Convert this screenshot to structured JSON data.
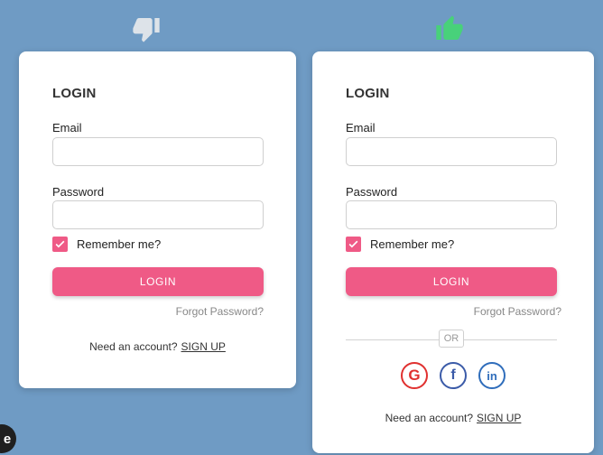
{
  "top_icons": {
    "left": {
      "icon": "thumbs-down-icon",
      "color": "#dde3e9"
    },
    "right": {
      "icon": "thumbs-up-icon",
      "color": "#48d17a"
    }
  },
  "left_card": {
    "title": "LOGIN",
    "email_label": "Email",
    "email_value": "",
    "password_label": "Password",
    "password_value": "",
    "remember_label": "Remember me?",
    "remember_checked": true,
    "login_button": "LOGIN",
    "forgot_password": "Forgot Password?",
    "signup_text": "Need an account?",
    "signup_link": "SIGN UP"
  },
  "right_card": {
    "title": "LOGIN",
    "email_label": "Email",
    "email_value": "",
    "password_label": "Password",
    "password_value": "",
    "remember_label": "Remember me?",
    "remember_checked": true,
    "login_button": "LOGIN",
    "forgot_password": "Forgot Password?",
    "divider_text": "OR",
    "social": [
      {
        "name": "Google",
        "glyph": "G",
        "icon": "google-icon",
        "color": "#e0302f"
      },
      {
        "name": "Facebook",
        "glyph": "f",
        "icon": "facebook-icon",
        "color": "#3b5ba8"
      },
      {
        "name": "LinkedIn",
        "glyph": "in",
        "icon": "linkedin-icon",
        "color": "#2f6dbb"
      }
    ],
    "signup_text": "Need an account?",
    "signup_link": "SIGN UP"
  },
  "colors": {
    "background": "#6f9bc4",
    "accent": "#ef5a86",
    "card": "#ffffff"
  },
  "corner_badge": "e"
}
